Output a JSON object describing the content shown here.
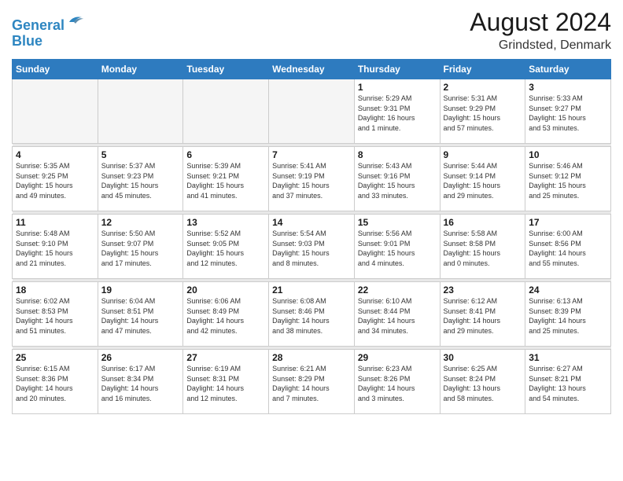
{
  "header": {
    "logo_line1": "General",
    "logo_line2": "Blue",
    "title": "August 2024",
    "location": "Grindsted, Denmark"
  },
  "days_of_week": [
    "Sunday",
    "Monday",
    "Tuesday",
    "Wednesday",
    "Thursday",
    "Friday",
    "Saturday"
  ],
  "weeks": [
    [
      {
        "day": "",
        "info": ""
      },
      {
        "day": "",
        "info": ""
      },
      {
        "day": "",
        "info": ""
      },
      {
        "day": "",
        "info": ""
      },
      {
        "day": "1",
        "info": "Sunrise: 5:29 AM\nSunset: 9:31 PM\nDaylight: 16 hours\nand 1 minute."
      },
      {
        "day": "2",
        "info": "Sunrise: 5:31 AM\nSunset: 9:29 PM\nDaylight: 15 hours\nand 57 minutes."
      },
      {
        "day": "3",
        "info": "Sunrise: 5:33 AM\nSunset: 9:27 PM\nDaylight: 15 hours\nand 53 minutes."
      }
    ],
    [
      {
        "day": "4",
        "info": "Sunrise: 5:35 AM\nSunset: 9:25 PM\nDaylight: 15 hours\nand 49 minutes."
      },
      {
        "day": "5",
        "info": "Sunrise: 5:37 AM\nSunset: 9:23 PM\nDaylight: 15 hours\nand 45 minutes."
      },
      {
        "day": "6",
        "info": "Sunrise: 5:39 AM\nSunset: 9:21 PM\nDaylight: 15 hours\nand 41 minutes."
      },
      {
        "day": "7",
        "info": "Sunrise: 5:41 AM\nSunset: 9:19 PM\nDaylight: 15 hours\nand 37 minutes."
      },
      {
        "day": "8",
        "info": "Sunrise: 5:43 AM\nSunset: 9:16 PM\nDaylight: 15 hours\nand 33 minutes."
      },
      {
        "day": "9",
        "info": "Sunrise: 5:44 AM\nSunset: 9:14 PM\nDaylight: 15 hours\nand 29 minutes."
      },
      {
        "day": "10",
        "info": "Sunrise: 5:46 AM\nSunset: 9:12 PM\nDaylight: 15 hours\nand 25 minutes."
      }
    ],
    [
      {
        "day": "11",
        "info": "Sunrise: 5:48 AM\nSunset: 9:10 PM\nDaylight: 15 hours\nand 21 minutes."
      },
      {
        "day": "12",
        "info": "Sunrise: 5:50 AM\nSunset: 9:07 PM\nDaylight: 15 hours\nand 17 minutes."
      },
      {
        "day": "13",
        "info": "Sunrise: 5:52 AM\nSunset: 9:05 PM\nDaylight: 15 hours\nand 12 minutes."
      },
      {
        "day": "14",
        "info": "Sunrise: 5:54 AM\nSunset: 9:03 PM\nDaylight: 15 hours\nand 8 minutes."
      },
      {
        "day": "15",
        "info": "Sunrise: 5:56 AM\nSunset: 9:01 PM\nDaylight: 15 hours\nand 4 minutes."
      },
      {
        "day": "16",
        "info": "Sunrise: 5:58 AM\nSunset: 8:58 PM\nDaylight: 15 hours\nand 0 minutes."
      },
      {
        "day": "17",
        "info": "Sunrise: 6:00 AM\nSunset: 8:56 PM\nDaylight: 14 hours\nand 55 minutes."
      }
    ],
    [
      {
        "day": "18",
        "info": "Sunrise: 6:02 AM\nSunset: 8:53 PM\nDaylight: 14 hours\nand 51 minutes."
      },
      {
        "day": "19",
        "info": "Sunrise: 6:04 AM\nSunset: 8:51 PM\nDaylight: 14 hours\nand 47 minutes."
      },
      {
        "day": "20",
        "info": "Sunrise: 6:06 AM\nSunset: 8:49 PM\nDaylight: 14 hours\nand 42 minutes."
      },
      {
        "day": "21",
        "info": "Sunrise: 6:08 AM\nSunset: 8:46 PM\nDaylight: 14 hours\nand 38 minutes."
      },
      {
        "day": "22",
        "info": "Sunrise: 6:10 AM\nSunset: 8:44 PM\nDaylight: 14 hours\nand 34 minutes."
      },
      {
        "day": "23",
        "info": "Sunrise: 6:12 AM\nSunset: 8:41 PM\nDaylight: 14 hours\nand 29 minutes."
      },
      {
        "day": "24",
        "info": "Sunrise: 6:13 AM\nSunset: 8:39 PM\nDaylight: 14 hours\nand 25 minutes."
      }
    ],
    [
      {
        "day": "25",
        "info": "Sunrise: 6:15 AM\nSunset: 8:36 PM\nDaylight: 14 hours\nand 20 minutes."
      },
      {
        "day": "26",
        "info": "Sunrise: 6:17 AM\nSunset: 8:34 PM\nDaylight: 14 hours\nand 16 minutes."
      },
      {
        "day": "27",
        "info": "Sunrise: 6:19 AM\nSunset: 8:31 PM\nDaylight: 14 hours\nand 12 minutes."
      },
      {
        "day": "28",
        "info": "Sunrise: 6:21 AM\nSunset: 8:29 PM\nDaylight: 14 hours\nand 7 minutes."
      },
      {
        "day": "29",
        "info": "Sunrise: 6:23 AM\nSunset: 8:26 PM\nDaylight: 14 hours\nand 3 minutes."
      },
      {
        "day": "30",
        "info": "Sunrise: 6:25 AM\nSunset: 8:24 PM\nDaylight: 13 hours\nand 58 minutes."
      },
      {
        "day": "31",
        "info": "Sunrise: 6:27 AM\nSunset: 8:21 PM\nDaylight: 13 hours\nand 54 minutes."
      }
    ]
  ]
}
